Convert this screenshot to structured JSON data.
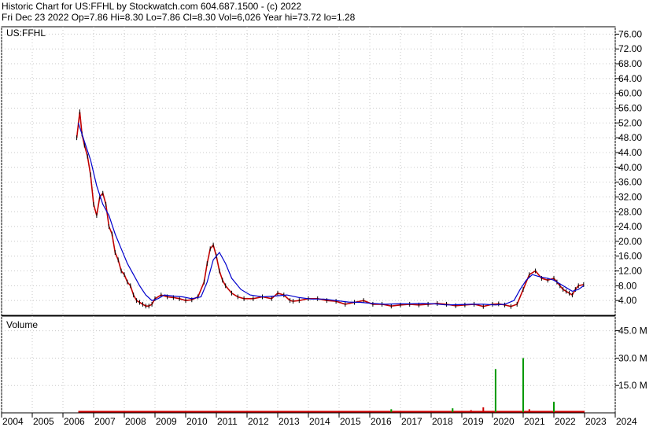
{
  "header": {
    "title_line": "Historic Chart for US:FFHL by Stockwatch.com 604.687.1500 - (c) 2022",
    "quote_line": "Fri Dec 23 2022   Op=7.86  Hi=8.30  Lo=7.86  Cl=8.30  Vol=6,026  Year hi=73.72  lo=1.28"
  },
  "chart_data": [
    {
      "type": "line",
      "title": "US:FFHL",
      "price_axis_ticks": [
        "76.00",
        "72.00",
        "68.00",
        "64.00",
        "60.00",
        "56.00",
        "52.00",
        "48.00",
        "44.00",
        "40.00",
        "36.00",
        "32.00",
        "28.00",
        "24.00",
        "20.00",
        "16.00",
        "12.00",
        "8.00",
        "4.00"
      ],
      "ylim": [
        0,
        78
      ],
      "x_labels": [
        "2004",
        "2005",
        "2006",
        "2007",
        "2008",
        "2009",
        "2010",
        "2011",
        "2012",
        "2013",
        "2014",
        "2015",
        "2016",
        "2017",
        "2018",
        "2019",
        "2020",
        "2021",
        "2022",
        "2023",
        "2024"
      ],
      "xlim": [
        2004.0,
        2024.0
      ],
      "grid": true,
      "series": [
        {
          "color": "#c00000",
          "x": [
            2006.45,
            2006.55,
            2006.62,
            2006.7,
            2006.8,
            2006.9,
            2007.0,
            2007.1,
            2007.2,
            2007.3,
            2007.4,
            2007.5,
            2007.6,
            2007.7,
            2007.8,
            2007.9,
            2008.0,
            2008.1,
            2008.2,
            2008.3,
            2008.4,
            2008.5,
            2008.6,
            2008.7,
            2008.8,
            2008.9,
            2009.0,
            2009.2,
            2009.4,
            2009.6,
            2009.8,
            2010.0,
            2010.2,
            2010.4,
            2010.6,
            2010.7,
            2010.8,
            2010.9,
            2011.0,
            2011.1,
            2011.2,
            2011.3,
            2011.5,
            2011.7,
            2011.9,
            2012.2,
            2012.5,
            2012.8,
            2013.0,
            2013.2,
            2013.4,
            2013.5,
            2013.7,
            2014.0,
            2014.3,
            2014.6,
            2014.9,
            2015.2,
            2015.5,
            2015.8,
            2016.1,
            2016.4,
            2016.7,
            2017.0,
            2017.3,
            2017.6,
            2017.9,
            2018.2,
            2018.5,
            2018.8,
            2019.1,
            2019.4,
            2019.7,
            2020.0,
            2020.2,
            2020.4,
            2020.6,
            2020.8,
            2021.0,
            2021.2,
            2021.4,
            2021.6,
            2021.8,
            2022.0,
            2022.1,
            2022.2,
            2022.3,
            2022.4,
            2022.5,
            2022.6,
            2022.7,
            2022.8,
            2022.97
          ],
          "y": [
            48,
            55,
            49,
            46,
            43,
            38,
            30,
            27,
            32,
            33,
            30,
            24,
            22,
            17,
            15,
            12,
            11,
            9,
            8,
            5.5,
            4,
            3.5,
            3,
            2.5,
            2.5,
            3,
            4.5,
            5.5,
            5,
            4.8,
            4.5,
            4,
            4.2,
            5,
            9,
            14,
            18,
            19,
            16,
            12,
            9.5,
            8,
            6,
            5,
            4.5,
            4.5,
            5,
            4.5,
            6,
            5.5,
            4,
            3.8,
            4,
            4.5,
            4.5,
            4,
            3.8,
            3,
            3.5,
            4,
            3,
            3,
            2.5,
            2.8,
            3,
            2.8,
            3,
            3.2,
            3,
            2.6,
            2.8,
            3,
            2.4,
            3,
            3.1,
            2.8,
            2.4,
            3,
            7,
            11,
            12,
            10,
            9.5,
            10,
            9,
            8,
            7,
            6.5,
            6,
            5.5,
            7,
            8,
            8.3
          ]
        },
        {
          "color": "#0000cc",
          "x": [
            2006.5,
            2006.7,
            2006.9,
            2007.1,
            2007.3,
            2007.5,
            2007.7,
            2007.9,
            2008.1,
            2008.3,
            2008.5,
            2008.7,
            2008.9,
            2009.1,
            2009.3,
            2009.6,
            2009.9,
            2010.2,
            2010.5,
            2010.7,
            2010.9,
            2011.1,
            2011.3,
            2011.5,
            2011.8,
            2012.1,
            2012.5,
            2012.9,
            2013.3,
            2013.7,
            2014.1,
            2014.5,
            2014.9,
            2015.3,
            2015.7,
            2016.1,
            2016.5,
            2016.9,
            2017.3,
            2017.7,
            2018.1,
            2018.5,
            2018.9,
            2019.3,
            2019.7,
            2020.1,
            2020.4,
            2020.7,
            2020.9,
            2021.1,
            2021.3,
            2021.5,
            2021.8,
            2022.0,
            2022.2,
            2022.4,
            2022.6,
            2022.8,
            2022.97
          ],
          "y": [
            52,
            47,
            42,
            35,
            30,
            27,
            22,
            18,
            14,
            11,
            8,
            5.5,
            4,
            4.5,
            5.5,
            5.2,
            5,
            4.5,
            5,
            9,
            15,
            17,
            14,
            10,
            7,
            5.5,
            5,
            5.2,
            5.5,
            4.8,
            4.4,
            4.4,
            4,
            3.6,
            3.5,
            3.2,
            3,
            3.1,
            3.1,
            3.2,
            3.1,
            2.8,
            2.9,
            3,
            3,
            2.8,
            3,
            4,
            7,
            9.5,
            11,
            10.5,
            10,
            9.5,
            8.5,
            7.5,
            6.5,
            7,
            8
          ]
        }
      ]
    },
    {
      "type": "bar",
      "title": "Volume",
      "volume_axis_ticks": [
        "45.0 M",
        "30.0 M",
        "15.0 M"
      ],
      "ylim": [
        0,
        53
      ],
      "xlim": [
        2004.0,
        2024.0
      ],
      "grid": true,
      "baseline_color": "#cc0000",
      "bars": [
        {
          "x": 2016.7,
          "value": 2,
          "color": "#009900"
        },
        {
          "x": 2018.7,
          "value": 2.5,
          "color": "#009900"
        },
        {
          "x": 2019.3,
          "value": 1.5,
          "color": "#cc0000"
        },
        {
          "x": 2019.7,
          "value": 3,
          "color": "#cc0000"
        },
        {
          "x": 2020.1,
          "value": 24,
          "color": "#009900"
        },
        {
          "x": 2021.0,
          "value": 30,
          "color": "#009900"
        },
        {
          "x": 2021.2,
          "value": 2,
          "color": "#cc0000"
        },
        {
          "x": 2022.0,
          "value": 6,
          "color": "#009900"
        }
      ]
    }
  ]
}
